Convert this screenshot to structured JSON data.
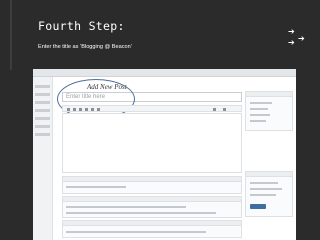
{
  "slide": {
    "title": "Fourth Step:",
    "subtitle": "Enter the title as ‘Blogging @ Beacon’"
  },
  "screenshot": {
    "heading": "Add New Post",
    "title_placeholder": "Enter title here"
  },
  "icons": {
    "arrows": [
      "arrow-right-icon",
      "arrow-right-icon",
      "arrow-right-icon"
    ]
  },
  "colors": {
    "slide_background": "#2b2b2b",
    "callout_ring": "#4f6f9a",
    "publish_button": "#3f6ea0"
  }
}
